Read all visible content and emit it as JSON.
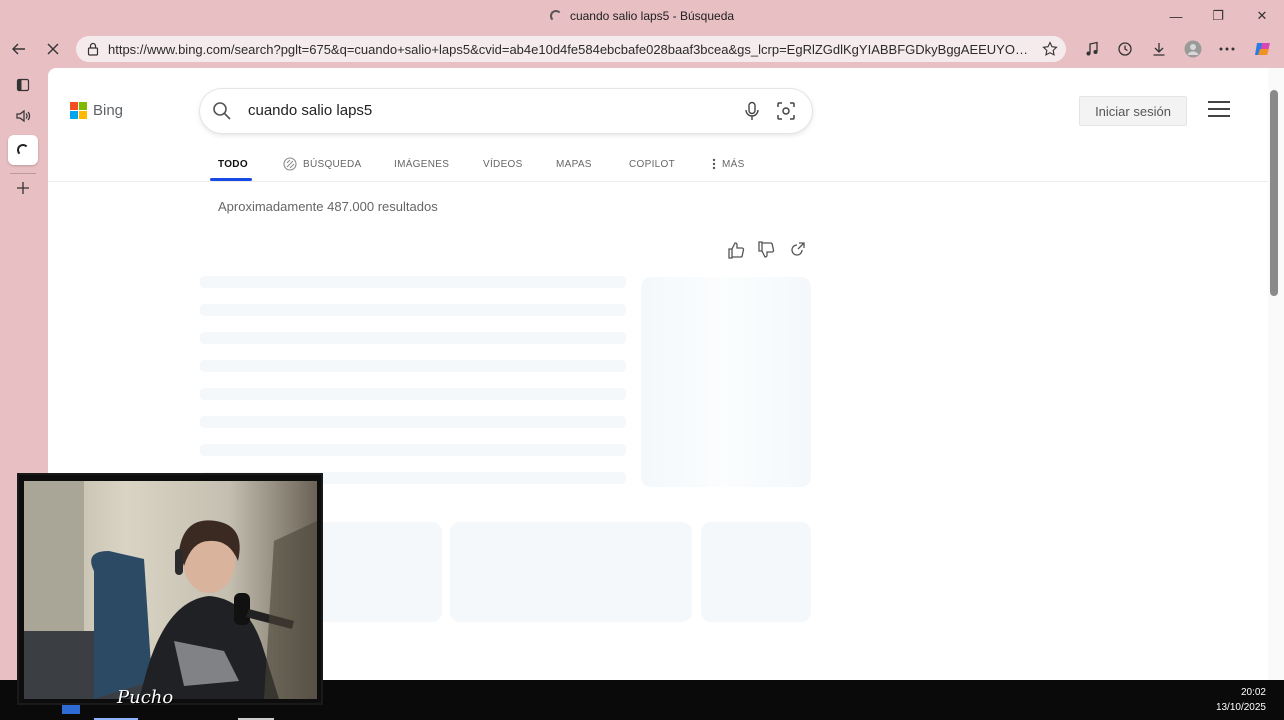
{
  "window": {
    "title": "cuando salio laps5 - Búsqueda",
    "minimize": "—",
    "restore": "❐",
    "close": "✕"
  },
  "toolbar": {
    "url": "https://www.bing.com/search?pglt=675&q=cuando+salio+laps5&cvid=ab4e10d4fe584ebcbafe028baaf3bcea&gs_lcrp=EgRlZGdlKgYIABBFGDkyBggAEEUYOT..."
  },
  "bing": {
    "logo_text": "Bing",
    "search_value": "cuando salio laps5",
    "signin_label": "Iniciar sesión",
    "nav": [
      {
        "label": "TODO"
      },
      {
        "label": "BÚSQUEDA"
      },
      {
        "label": "IMÁGENES"
      },
      {
        "label": "VÍDEOS"
      },
      {
        "label": "MAPAS"
      },
      {
        "label": "COPILOT"
      },
      {
        "label": "MÁS"
      }
    ],
    "result_count": "Aproximadamente 487.000 resultados"
  },
  "taskbar": {
    "time": "20:02",
    "date": "13/10/2025"
  },
  "webcam": {
    "overlay_text": "Pucho"
  },
  "colors": {
    "frame": "#e8bfc3",
    "accent": "#174ae4",
    "skeleton": "#f4f8fb"
  }
}
